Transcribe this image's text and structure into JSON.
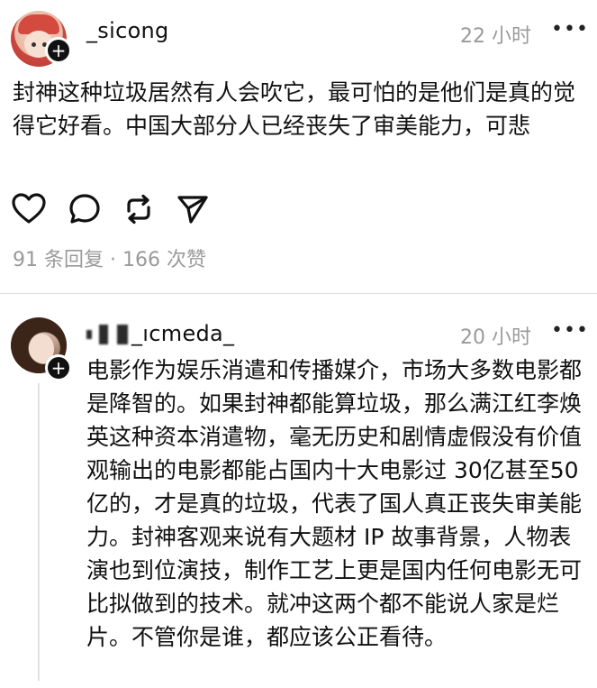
{
  "post1": {
    "username": "_sicong",
    "time": "22 小时",
    "more": "•••",
    "text": "封神这种垃圾居然有人会吹它，最可怕的是他们是真的觉得它好看。中国大部分人已经丧失了审美能力，可悲",
    "stats": "91 条回复 · 166 次赞",
    "follow_plus": "+"
  },
  "post2": {
    "username_visible": "_ıcmeda_",
    "time": "20 小时",
    "more": "•••",
    "text": "电影作为娱乐消遣和传播媒介，市场大多数电影都是降智的。如果封神都能算垃圾，那么满江红李焕英这种资本消遣物，毫无历史和剧情虚假没有价值观输出的电影都能占国内十大电影过 30亿甚至50亿的，才是真的垃圾，代表了国人真正丧失审美能力。封神客观来说有大题材 IP 故事背景，人物表演也到位演技，制作工艺上更是国内任何电影无可比拟做到的技术。就冲这两个都不能说人家是烂片。不管你是谁，都应该公正看待。",
    "follow_plus": "+"
  },
  "icons": {
    "like": "heart-icon",
    "comment": "comment-icon",
    "repost": "repost-icon",
    "share": "send-icon"
  }
}
